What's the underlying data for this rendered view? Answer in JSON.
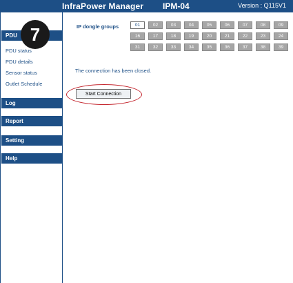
{
  "header": {
    "app_title": "InfraPower Manager",
    "device_name": "IPM-04",
    "version": "Version : Q115V1"
  },
  "badge": {
    "number": "7"
  },
  "sidebar": {
    "sections": {
      "pdu": "PDU",
      "log": "Log",
      "report": "Report",
      "setting": "Setting",
      "help": "Help"
    },
    "pdu_items": [
      "PDU status",
      "PDU details",
      "Sensor status",
      "Outlet Schedule"
    ]
  },
  "main": {
    "ip_label": "IP dongle groups",
    "groups_row1": [
      "01",
      "02",
      "03",
      "04",
      "05",
      "06",
      "07",
      "08",
      "09"
    ],
    "groups_row2": [
      "16",
      "17",
      "18",
      "19",
      "20",
      "21",
      "22",
      "23",
      "24"
    ],
    "groups_row3": [
      "31",
      "32",
      "33",
      "34",
      "35",
      "36",
      "37",
      "38",
      "39"
    ],
    "active_group": "01",
    "message": "The connection has been closed.",
    "start_button": "Start Connection"
  },
  "colors": {
    "brand": "#1d4f86",
    "inactive_group": "#a6a6a6",
    "highlight": "#c4262e"
  }
}
